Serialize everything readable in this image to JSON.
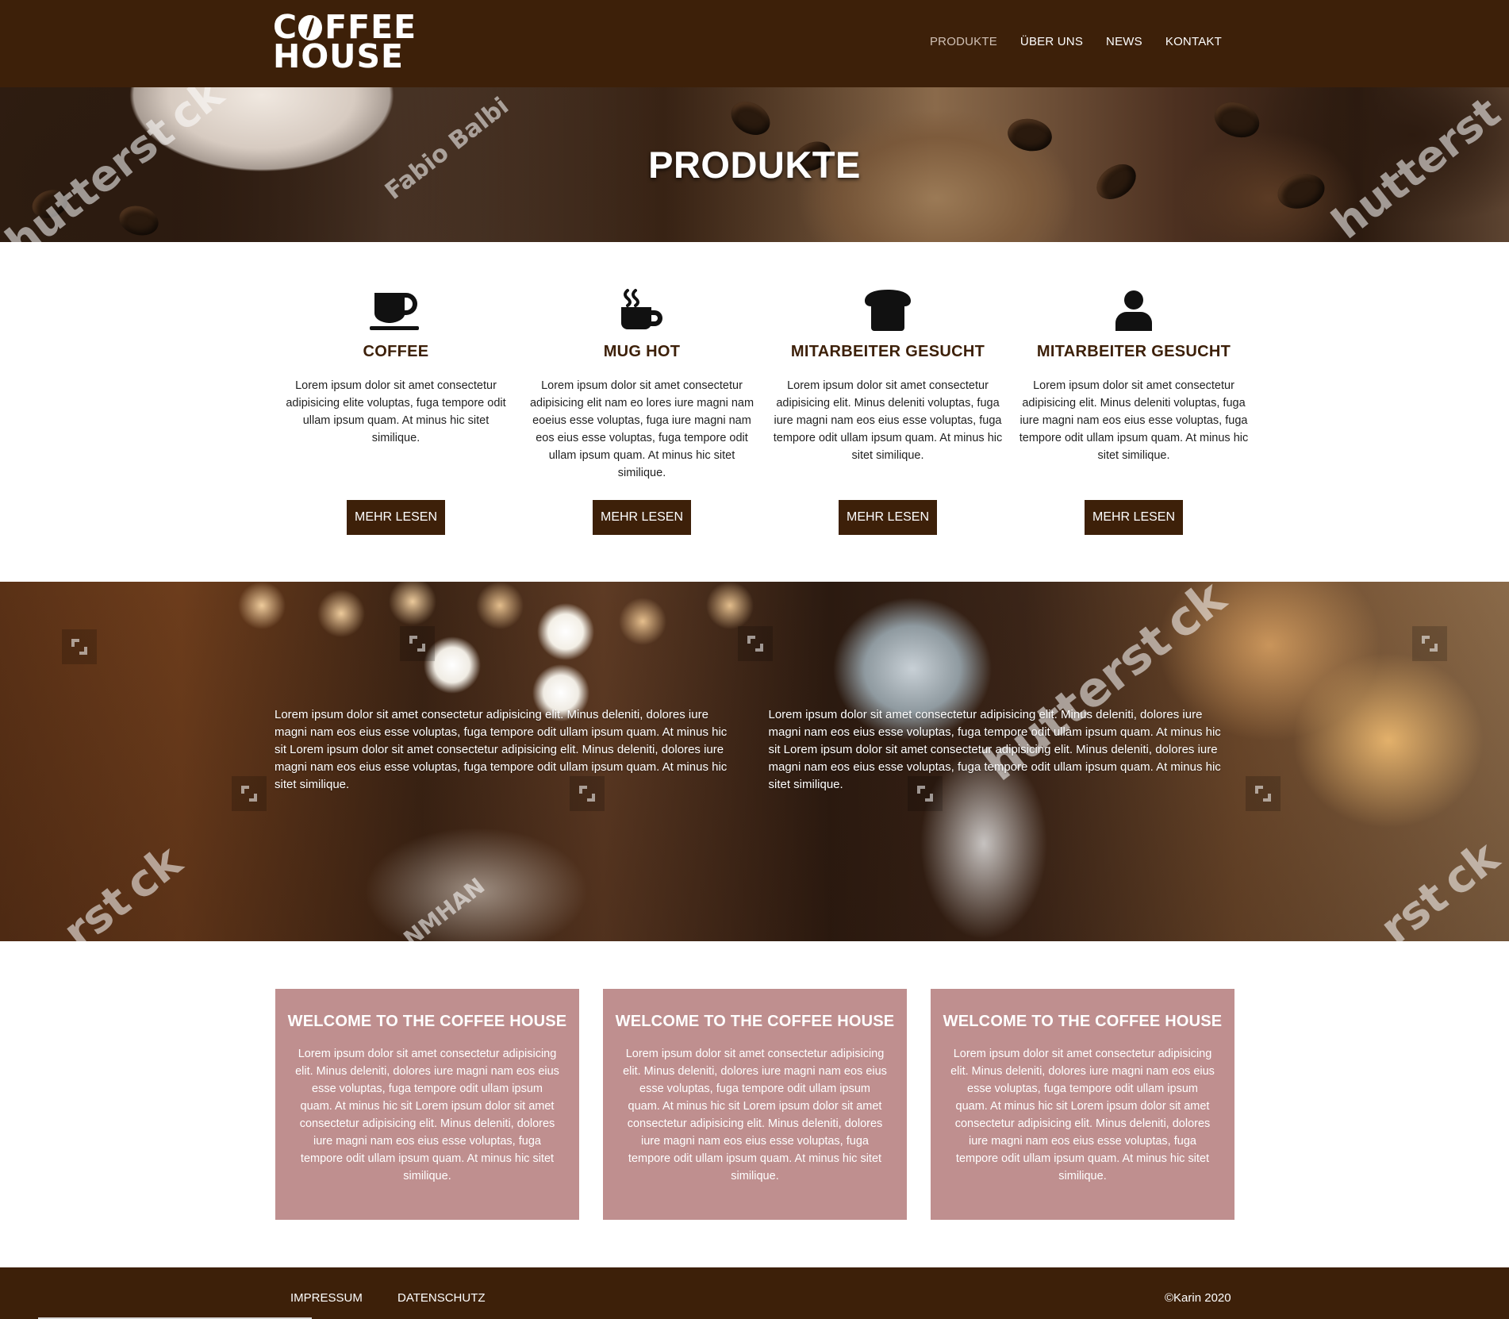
{
  "header": {
    "logo_line1_a": "C",
    "logo_line1_b": "FFEE",
    "logo_line2": "HOUSE",
    "nav": [
      {
        "label": "PRODUKTE",
        "active": true
      },
      {
        "label": "ÜBER UNS",
        "active": false
      },
      {
        "label": "NEWS",
        "active": false
      },
      {
        "label": "KONTAKT",
        "active": false
      }
    ]
  },
  "hero": {
    "title": "PRODUKTE",
    "watermarks": [
      "hutterst ck",
      "Fabio Balbi",
      "hutterst"
    ]
  },
  "products": [
    {
      "icon": "coffee-cup-icon",
      "title": "COFFEE",
      "text": "Lorem ipsum dolor sit amet consectetur adipisicing elite voluptas, fuga tempore odit ullam ipsum quam. At minus hic sitet similique.",
      "button": "MEHR LESEN"
    },
    {
      "icon": "mug-hot-icon",
      "title": "MUG HOT",
      "text": "Lorem ipsum dolor sit amet consectetur adipisicing elit nam eo lores iure magni nam eoeius esse voluptas, fuga iure magni nam eos eius esse voluptas, fuga tempore odit ullam ipsum quam. At minus hic sitet similique.",
      "button": "MEHR LESEN"
    },
    {
      "icon": "bread-icon",
      "title": "MITARBEITER GESUCHT",
      "text": "Lorem ipsum dolor sit amet consectetur adipisicing elit. Minus deleniti voluptas, fuga iure magni nam eos eius esse voluptas, fuga tempore odit ullam ipsum quam. At minus hic sitet similique.",
      "button": "MEHR LESEN"
    },
    {
      "icon": "user-icon",
      "title": "MITARBEITER GESUCHT",
      "text": "Lorem ipsum dolor sit amet consectetur adipisicing elit. Minus deleniti voluptas, fuga iure magni nam eos eius esse voluptas, fuga tempore odit ullam ipsum quam. At minus hic sitet similique.",
      "button": "MEHR LESEN"
    }
  ],
  "cafe": {
    "columns": [
      "Lorem ipsum dolor sit amet consectetur adipisicing elit. Minus deleniti, dolores iure magni nam eos eius esse voluptas, fuga tempore odit ullam ipsum quam. At minus hic sit Lorem ipsum dolor sit amet consectetur adipisicing elit. Minus deleniti, dolores iure magni nam eos eius esse voluptas, fuga tempore odit ullam ipsum quam. At minus hic sitet similique.",
      "Lorem ipsum dolor sit amet consectetur adipisicing elit. Minus deleniti, dolores iure magni nam eos eius esse voluptas, fuga tempore odit ullam ipsum quam. At minus hic sit Lorem ipsum dolor sit amet consectetur adipisicing elit. Minus deleniti, dolores iure magni nam eos eius esse voluptas, fuga tempore odit ullam ipsum quam. At minus hic sitet similique."
    ],
    "watermarks": [
      "hutterst ck",
      "rst ck",
      "NMHAN",
      "rst ck"
    ]
  },
  "cards": [
    {
      "title": "WELCOME TO THE COFFEE HOUSE",
      "text": "Lorem ipsum dolor sit amet consectetur adipisicing elit. Minus deleniti, dolores iure magni nam eos eius esse voluptas, fuga tempore odit ullam ipsum quam. At minus hic sit Lorem ipsum dolor sit amet consectetur adipisicing elit. Minus deleniti, dolores iure magni nam eos eius esse voluptas, fuga tempore odit ullam ipsum quam. At minus hic sitet similique."
    },
    {
      "title": "WELCOME TO THE COFFEE HOUSE",
      "text": "Lorem ipsum dolor sit amet consectetur adipisicing elit. Minus deleniti, dolores iure magni nam eos eius esse voluptas, fuga tempore odit ullam ipsum quam. At minus hic sit Lorem ipsum dolor sit amet consectetur adipisicing elit. Minus deleniti, dolores iure magni nam eos eius esse voluptas, fuga tempore odit ullam ipsum quam. At minus hic sitet similique."
    },
    {
      "title": "WELCOME TO THE COFFEE HOUSE",
      "text": "Lorem ipsum dolor sit amet consectetur adipisicing elit. Minus deleniti, dolores iure magni nam eos eius esse voluptas, fuga tempore odit ullam ipsum quam. At minus hic sit Lorem ipsum dolor sit amet consectetur adipisicing elit. Minus deleniti, dolores iure magni nam eos eius esse voluptas, fuga tempore odit ullam ipsum quam. At minus hic sitet similique."
    }
  ],
  "footer": {
    "links": [
      "IMPRESSUM",
      "DATENSCHUTZ"
    ],
    "copyright": "©Karin 2020"
  },
  "colors": {
    "brand_brown": "#3d2009",
    "card_rose": "#bf8f8f",
    "nav_active": "#d0c0b4"
  }
}
